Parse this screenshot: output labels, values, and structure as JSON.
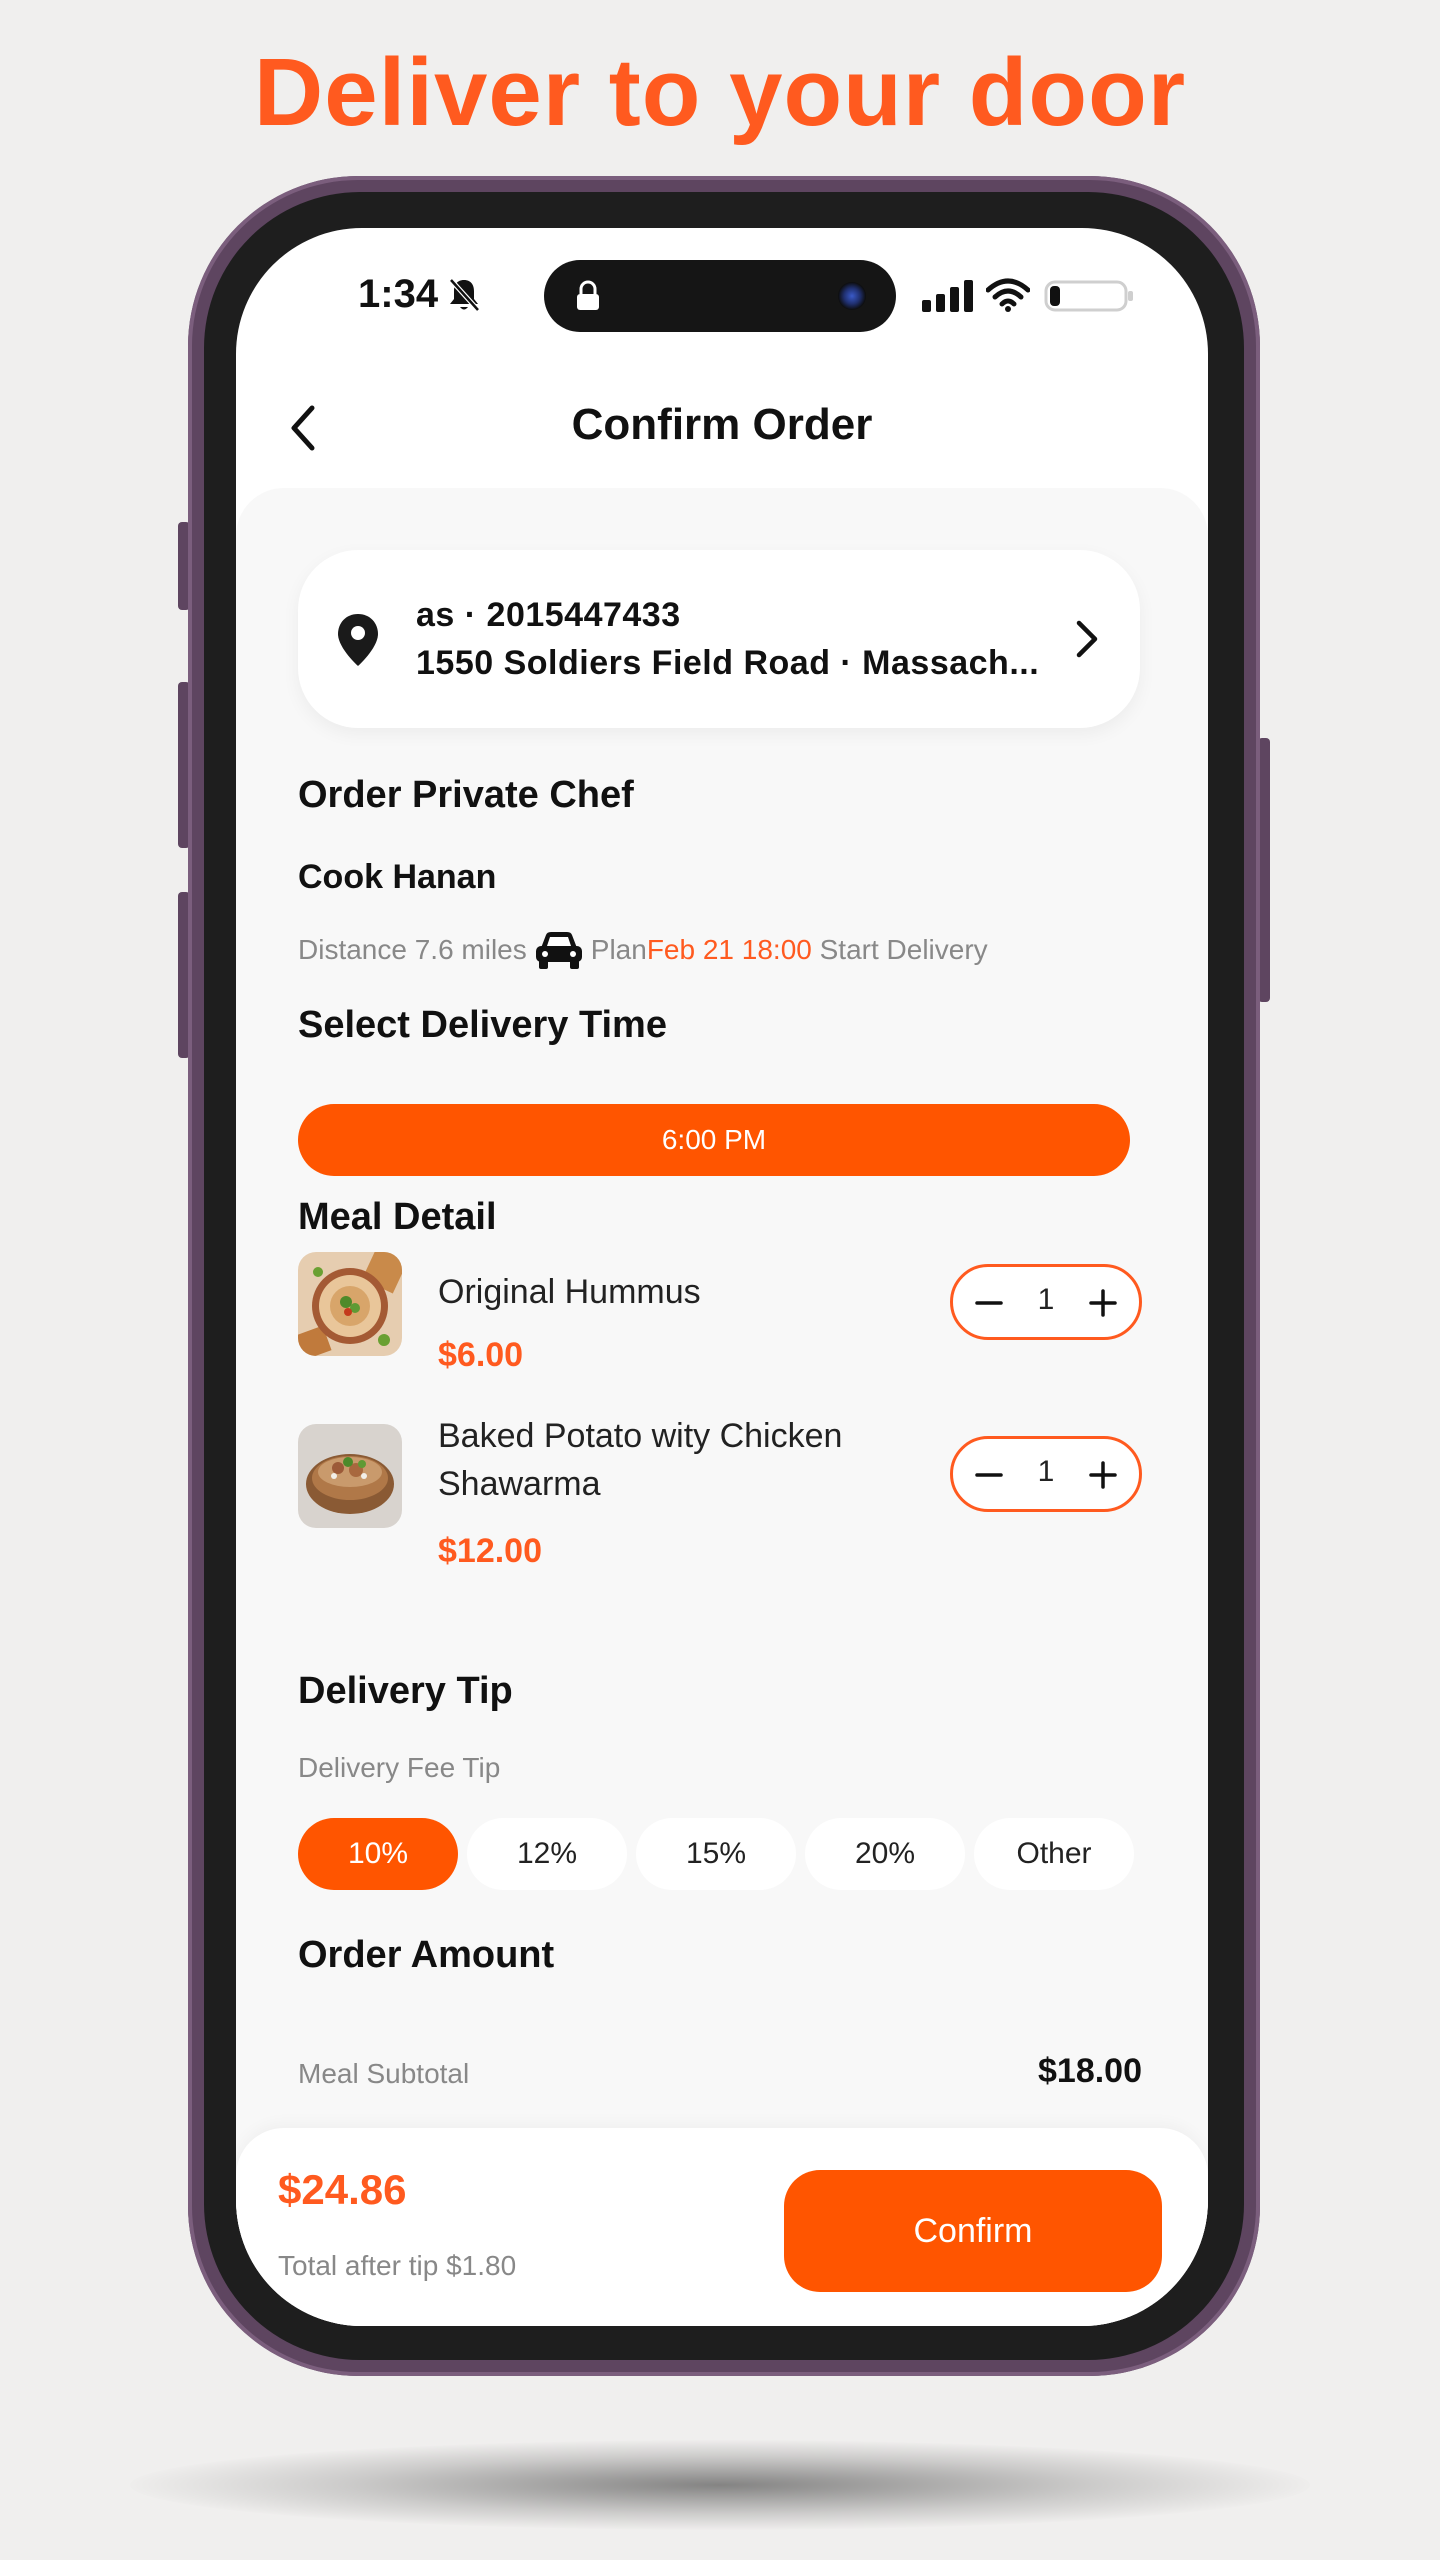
{
  "headline": "Deliver to your door",
  "status_bar": {
    "time": "1:34"
  },
  "header": {
    "title": "Confirm Order"
  },
  "address": {
    "line1": "as · 2015447433",
    "line2": "1550 Soldiers Field Road · Massach..."
  },
  "order_section": {
    "title": "Order Private Chef",
    "cook": "Cook Hanan",
    "distance": "Distance 7.6 miles",
    "plan_label": "Plan",
    "plan_time": "Feb 21 18:00",
    "start_delivery": " Start Delivery"
  },
  "delivery_time": {
    "title": "Select Delivery Time",
    "selected": "6:00 PM"
  },
  "meal_detail": {
    "title": "Meal Detail",
    "items": [
      {
        "name": "Original Hummus",
        "price": "$6.00",
        "qty": "1"
      },
      {
        "name": "Baked Potato wity Chicken Shawarma",
        "price": "$12.00",
        "qty": "1"
      }
    ]
  },
  "tip": {
    "title": "Delivery Tip",
    "subtitle": "Delivery Fee Tip",
    "options": [
      "10%",
      "12%",
      "15%",
      "20%",
      "Other"
    ],
    "selected": "10%"
  },
  "amount": {
    "title": "Order Amount",
    "subtotal_label": "Meal Subtotal",
    "subtotal_value": "$18.00"
  },
  "footer": {
    "total": "$24.86",
    "note": "Total after tip $1.80",
    "confirm_label": "Confirm"
  },
  "colors": {
    "accent": "#ff5500",
    "frame": "#5e4560"
  }
}
